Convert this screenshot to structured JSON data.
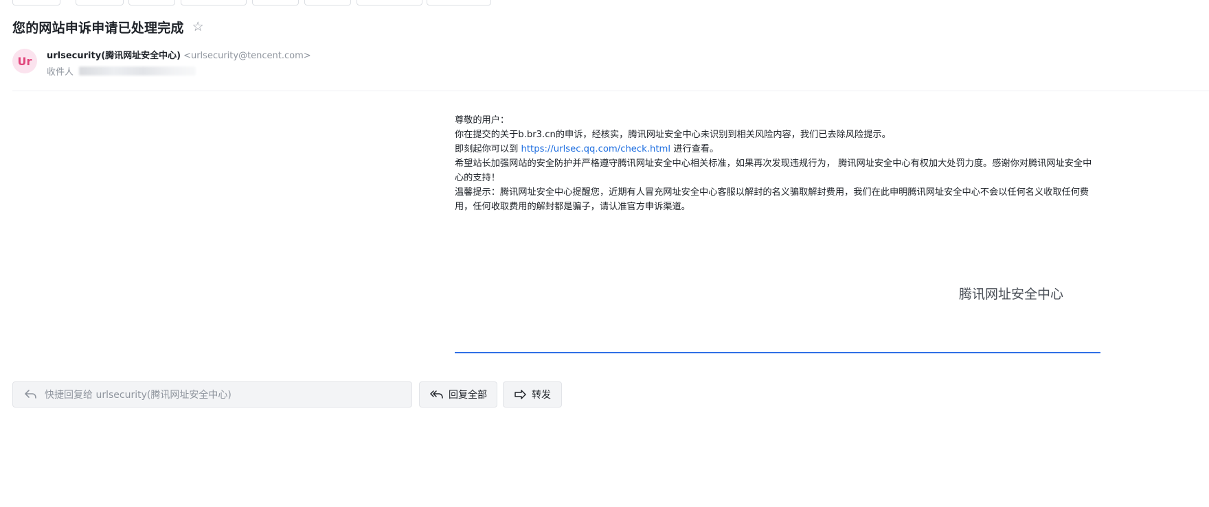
{
  "email": {
    "subject": "您的网站申诉申请已处理完成",
    "sender": {
      "avatar_initials": "Ur",
      "name": "urlsecurity(腾讯网址安全中心)",
      "email": "<urlsecurity@tencent.com>"
    },
    "recipient_label": "收件人"
  },
  "body": {
    "greeting": "尊敬的用户：",
    "line1": "你在提交的关于b.br3.cn的申诉，经核实，腾讯网址安全中心未识别到相关风险内容，我们已去除风险提示。",
    "line2_prefix": "即刻起你可以到",
    "line2_link": "https://urlsec.qq.com/check.html",
    "line2_suffix": "进行查看。",
    "line3": "希望站长加强网站的安全防护并严格遵守腾讯网址安全中心相关标准，如果再次发现违规行为， 腾讯网址安全中心有权加大处罚力度。感谢你对腾讯网址安全中心的支持！",
    "line4": "温馨提示：腾讯网址安全中心提醒您，近期有人冒充网址安全中心客服以解封的名义骗取解封费用，我们在此申明腾讯网址安全中心不会以任何名义收取任何费用，任何收取费用的解封都是骗子，请认准官方申诉渠道。",
    "signature": "腾讯网址安全中心"
  },
  "actions": {
    "quick_reply_placeholder": "快捷回复给 urlsecurity(腾讯网址安全中心)",
    "reply_all": "回复全部",
    "forward": "转发"
  },
  "colors": {
    "link": "#1f6fe0",
    "avatar_bg": "#fbe3ee",
    "avatar_text": "#e0457b",
    "signature_rule": "#2f6fe6"
  },
  "icons": {
    "star": "star-icon",
    "reply": "reply-icon",
    "reply_all": "reply-all-icon",
    "forward": "forward-icon"
  }
}
